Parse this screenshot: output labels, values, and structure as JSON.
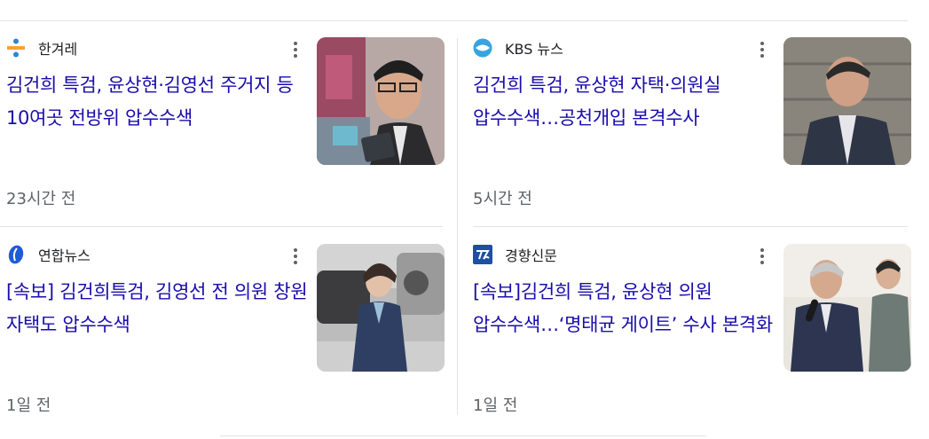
{
  "articles": [
    {
      "source": "한겨레",
      "source_icon": "hankyoreh-logo-icon",
      "title": "김건희 특검, 윤상현·김영선 주거지 등 10여곳 전방위 압수수색",
      "time": "23시간 전",
      "thumbnail": "man-with-glasses-photo"
    },
    {
      "source": "KBS 뉴스",
      "source_icon": "kbs-logo-icon",
      "title": "김건희 특검, 윤상현 자택·의원실 압수수색…공천개입 본격수사",
      "time": "5시간 전",
      "thumbnail": "man-in-suit-photo"
    },
    {
      "source": "연합뉴스",
      "source_icon": "yonhap-logo-icon",
      "title": "[속보] 김건희특검, 김영선 전 의원 창원 자택도 압수수색",
      "time": "1일 전",
      "thumbnail": "woman-walking-photo"
    },
    {
      "source": "경향신문",
      "source_icon": "kyunghyang-logo-icon",
      "title": "[속보]김건희 특검, 윤상현 의원 압수수색…‘명태균 게이트’ 수사 본격화",
      "time": "1일 전",
      "thumbnail": "man-with-microphone-photo"
    }
  ],
  "colors": {
    "link": "#1a0dab",
    "meta": "#5f6368",
    "divider": "#e3e3e3"
  }
}
